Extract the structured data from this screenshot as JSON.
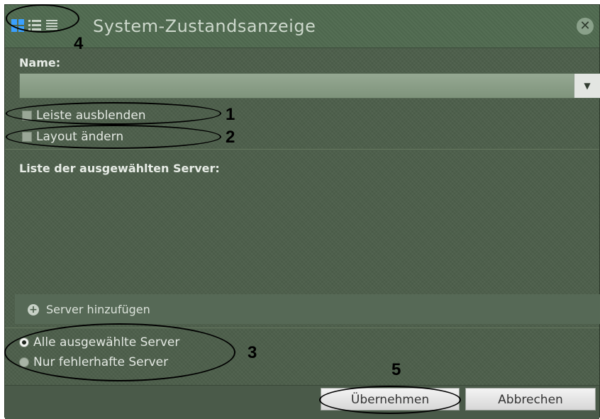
{
  "window": {
    "title": "System-Zustandsanzeige",
    "close_icon": "close-icon"
  },
  "view_icons": [
    "grid-view-icon",
    "list-view-icon",
    "detail-view-icon"
  ],
  "form": {
    "name_label": "Name:",
    "name_value": "",
    "hide_bar_label": "Leiste ausblenden",
    "change_layout_label": "Layout ändern"
  },
  "server_list": {
    "title": "Liste der ausgewählten Server:",
    "items": [],
    "add_label": "Server hinzufügen"
  },
  "radio_options": [
    {
      "label": "Alle ausgewählte Server",
      "checked": true
    },
    {
      "label": "Nur fehlerhafte Server",
      "checked": false
    }
  ],
  "buttons": {
    "apply": "Übernehmen",
    "cancel": "Abbrechen"
  },
  "annotations": [
    "1",
    "2",
    "3",
    "4",
    "5"
  ],
  "colors": {
    "background": "#4c5e4a",
    "accent": "#3aa0ff"
  }
}
